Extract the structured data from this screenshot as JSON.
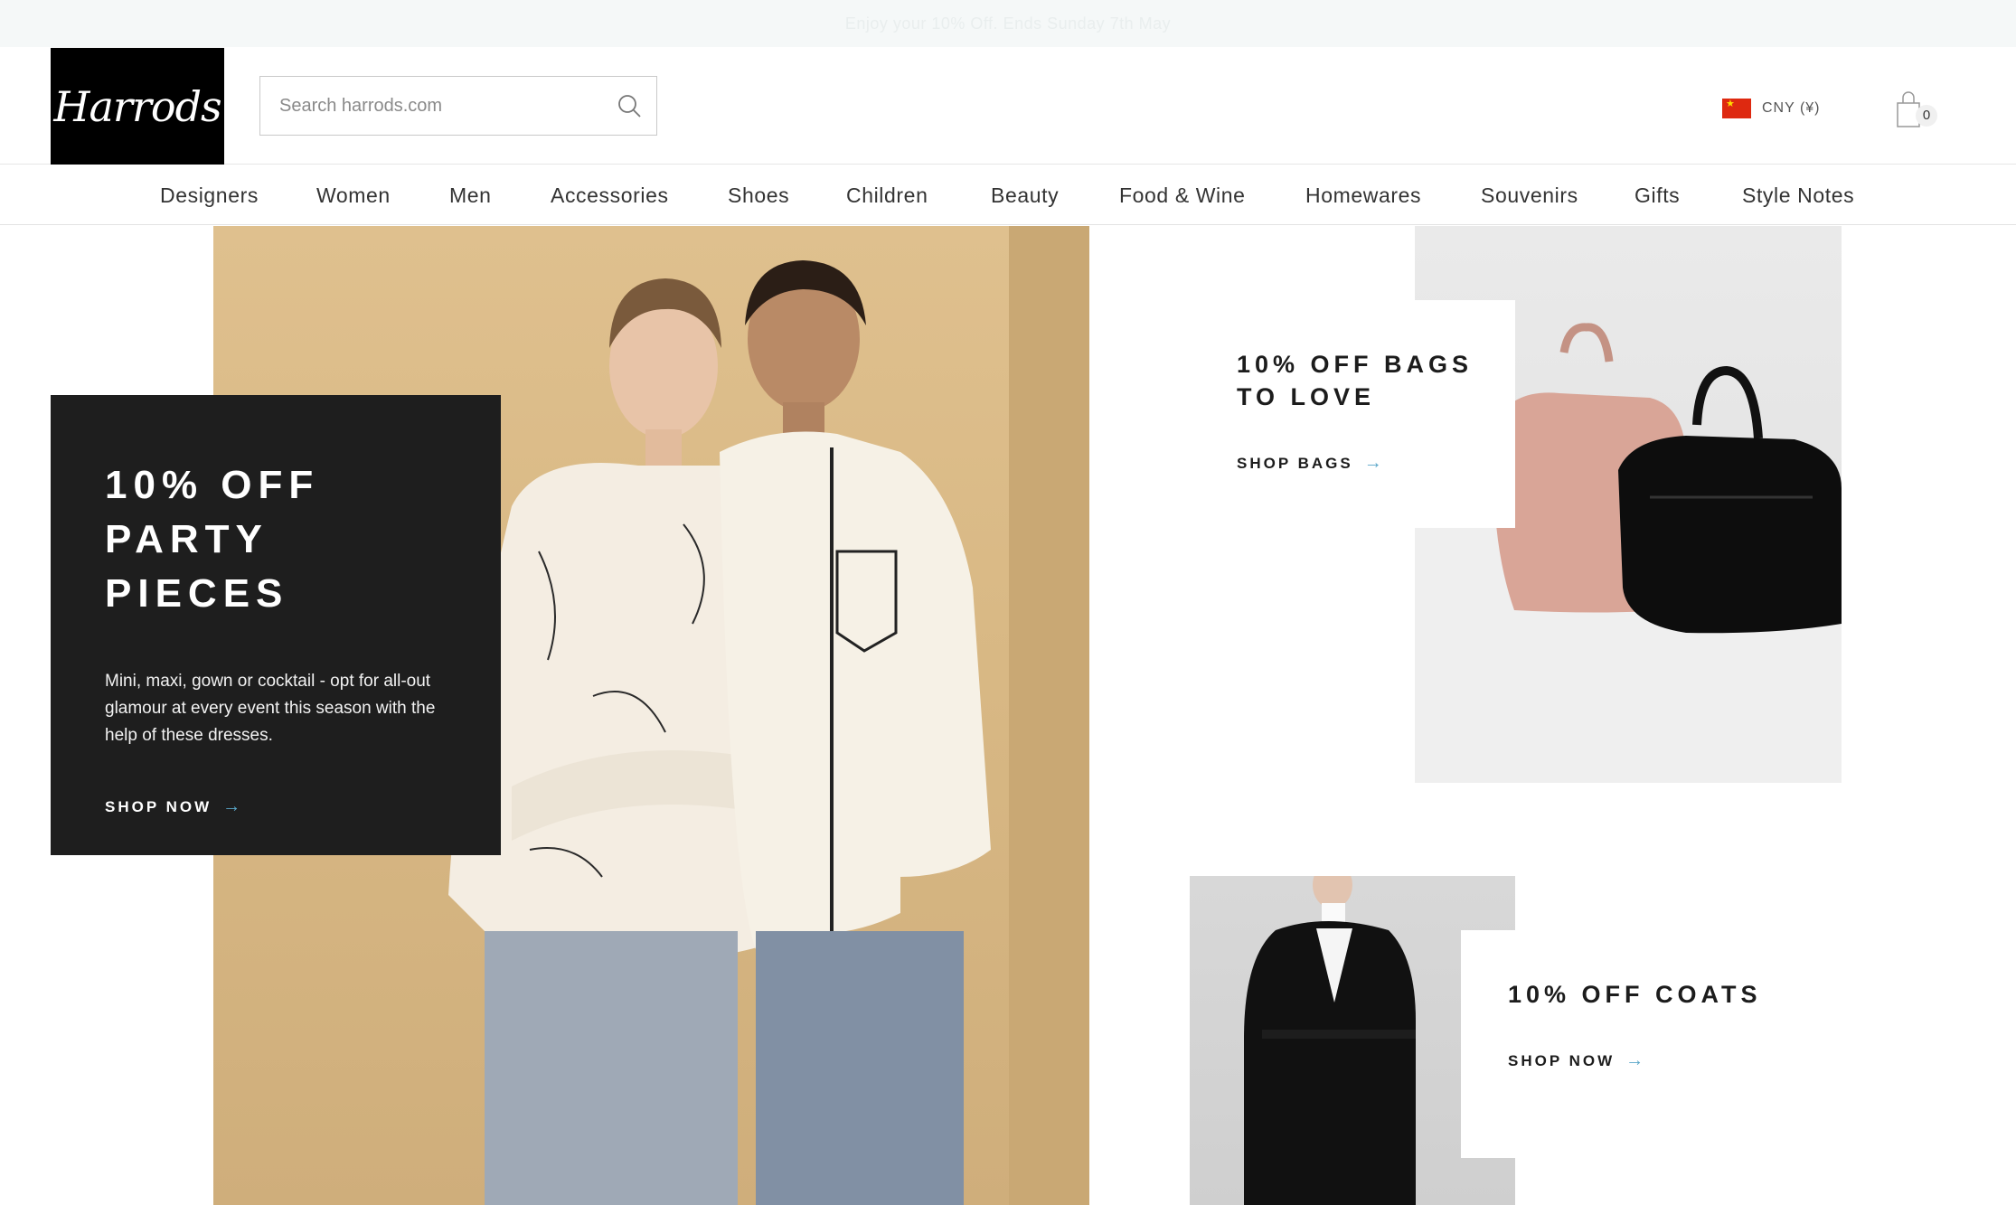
{
  "promo": {
    "text": "Enjoy your 10% Off. Ends Sunday 7th May"
  },
  "header": {
    "logo_text": "Harrods",
    "search_placeholder": "Search harrods.com",
    "currency": "CNY (¥)",
    "bag_count": "0"
  },
  "nav": {
    "items": [
      "Designers",
      "Women",
      "Men",
      "Accessories",
      "Shoes",
      "Children",
      "Beauty",
      "Food & Wine",
      "Homewares",
      "Souvenirs",
      "Gifts",
      "Style Notes"
    ]
  },
  "hero": {
    "title": "10% OFF PARTY PIECES",
    "description": "Mini, maxi, gown or cocktail - opt for all-out glamour at every event this season with the help of these dresses.",
    "cta": "SHOP NOW"
  },
  "bags": {
    "title": "10% OFF BAGS TO LOVE",
    "cta": "SHOP BAGS"
  },
  "coats": {
    "title": "10% OFF COATS",
    "cta": "SHOP NOW"
  },
  "colors": {
    "accent_arrow": "#5aa7c9",
    "card_dark": "#1e1e1e",
    "promo_bg": "#f5f8f8"
  }
}
